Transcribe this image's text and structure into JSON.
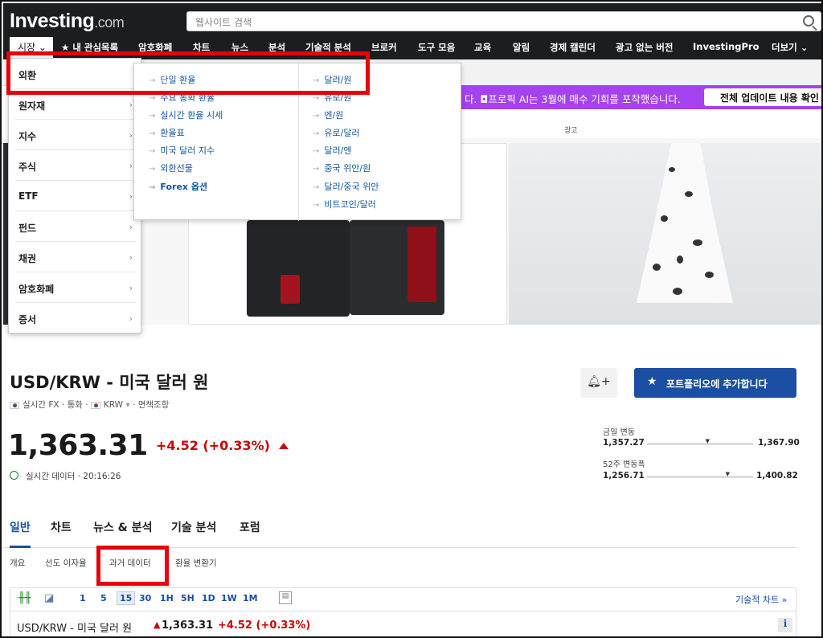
{
  "header": {
    "logo_main": "Investing",
    "logo_suffix": ".com",
    "search_placeholder": "웹사이트 검색"
  },
  "nav": {
    "items": [
      "시장",
      "★ 내 관심목록",
      "암호화폐",
      "차트",
      "뉴스",
      "분석",
      "기술적 분석",
      "브로커",
      "도구 모음",
      "교육",
      "알림",
      "경제 캘린더",
      "광고 없는 버전",
      "InvestingPro",
      "더보기"
    ]
  },
  "promo": {
    "text": "다. ◘프로픽 AI는 3월에 매수 기회를 포착했습니다.",
    "button": "전체 업데이트 내용 확인"
  },
  "ad_label": "광고",
  "market_menu": {
    "items": [
      "외환",
      "원자재",
      "지수",
      "주식",
      "ETF",
      "펀드",
      "채권",
      "암호화폐",
      "증서"
    ]
  },
  "fx_submenu": {
    "left": [
      "단일 환율",
      "주요 통화 환율",
      "실시간 환율 시세",
      "환율표",
      "미국 달러 지수",
      "외환선물",
      "Forex 옵션"
    ],
    "right": [
      "달러/원",
      "유로/원",
      "엔/원",
      "유로/달러",
      "달러/엔",
      "중국 위안/원",
      "달러/중국 위안",
      "비트코인/달러"
    ]
  },
  "instrument": {
    "title": "USD/KRW - 미국 달러 원",
    "meta_source": "실시간 FX",
    "meta_type": "통화",
    "meta_currency": "KRW",
    "meta_disclaimer": "면책조항",
    "price": "1,363.31",
    "change": "+4.52 (+0.33%)",
    "realtime": "실시간 데이터 · 20:16:26",
    "portfolio_button": "포트폴리오에 추가합니다"
  },
  "ranges": {
    "day_label": "금일 변동",
    "day_low": "1,357.27",
    "day_high": "1,367.90",
    "day_level": 0.55,
    "week52_label": "52주 변동폭",
    "week52_low": "1,256.71",
    "week52_high": "1,400.82",
    "week52_level": 0.74
  },
  "tabs": [
    "일반",
    "차트",
    "뉴스 & 분석",
    "기술 분석",
    "포럼"
  ],
  "subtabs": [
    "개요",
    "선도 이자율",
    "과거 데이터",
    "환율 변환기"
  ],
  "toolbar": {
    "timeframes": [
      "1",
      "5",
      "15",
      "30",
      "1H",
      "5H",
      "1D",
      "1W",
      "1M"
    ],
    "selected": "15",
    "tech_chart_link": "기술적 차트 »"
  },
  "ticker_row": {
    "name": "USD/KRW - 미국 달러 원",
    "value": "1,363.31",
    "change": "+4.52 (+0.33%)"
  },
  "colors": {
    "accent_blue": "#1a4fa3",
    "down_red": "#cc0000",
    "promo_purple": "#a442f0",
    "highlight_red": "#e8000a"
  }
}
